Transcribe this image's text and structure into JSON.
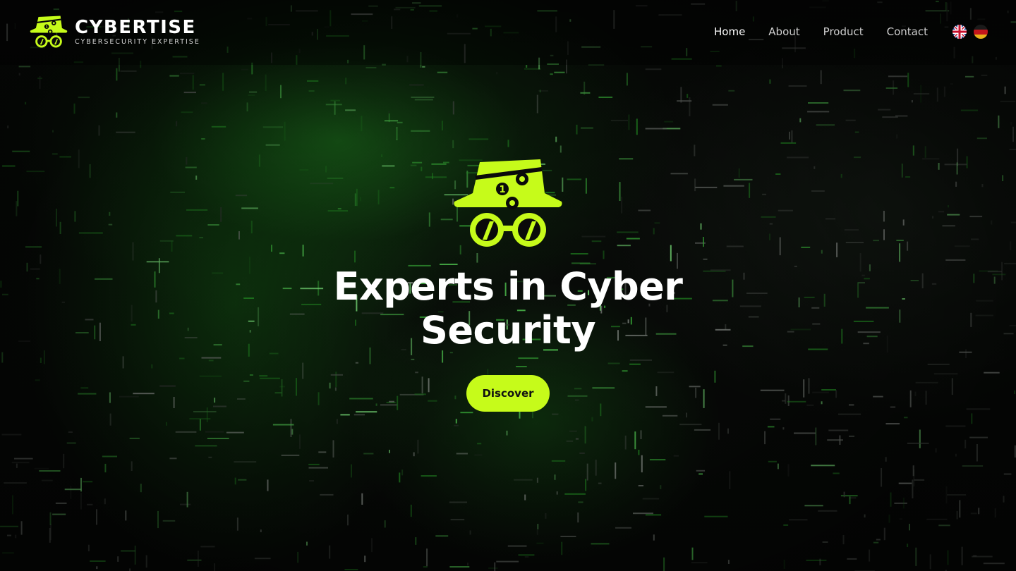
{
  "brand": {
    "name": "CYBERTISE",
    "tagline": "CYBERSECURITY EXPERTISE",
    "accent_color": "#c6fb1a",
    "logo_icon": "spy-hat-glasses-icon"
  },
  "nav": {
    "items": [
      {
        "label": "Home",
        "active": true
      },
      {
        "label": "About",
        "active": false
      },
      {
        "label": "Product",
        "active": false
      },
      {
        "label": "Contact",
        "active": false
      }
    ]
  },
  "languages": [
    {
      "icon": "uk-flag-icon"
    },
    {
      "icon": "germany-flag-icon"
    }
  ],
  "hero": {
    "icon": "spy-hat-glasses-icon",
    "title_line1": "Experts in Cyber",
    "title_line2": "Security",
    "cta_label": "Discover",
    "background": "green-digital-matrix-image"
  }
}
